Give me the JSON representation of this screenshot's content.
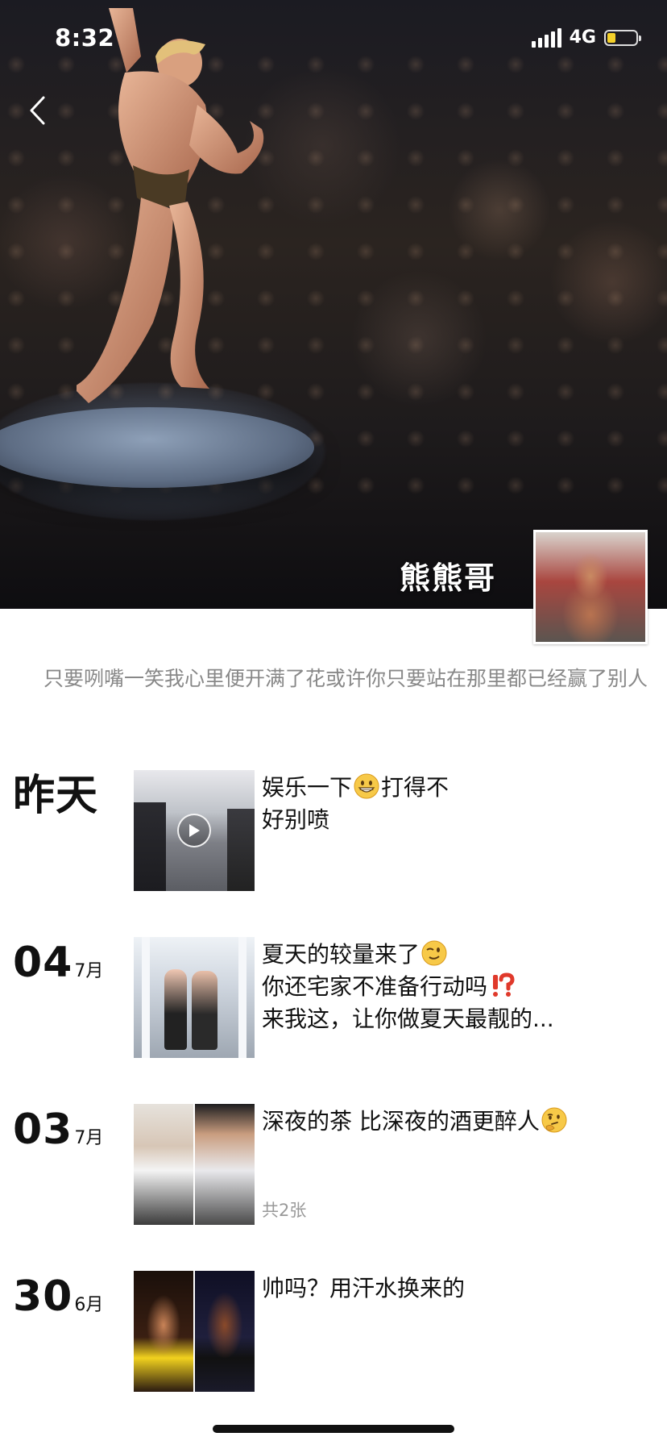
{
  "status_bar": {
    "time": "8:32",
    "network": "4G",
    "battery_percent": 30
  },
  "profile": {
    "name": "熊熊哥",
    "signature": "只要咧嘴一笑我心里便开满了花或许你只要站在那里都已经赢了别人"
  },
  "icons": {
    "back": "chevron-left-icon",
    "play": "play-icon",
    "signal": "signal-icon",
    "battery": "battery-icon"
  },
  "colors": {
    "battery_fill": "#f5d12a",
    "text_primary": "#111111",
    "text_secondary": "#888888"
  },
  "feed": [
    {
      "date_day": "昨天",
      "date_month": "",
      "lines": [
        "娱乐一下",
        "打得不",
        "好别喷"
      ],
      "type": "video"
    },
    {
      "date_day": "04",
      "date_month": "7月",
      "lines": [
        "夏天的较量来了",
        "你还宅家不准备行动吗",
        "来我这，让你做夏天最靓的..."
      ],
      "type": "image"
    },
    {
      "date_day": "03",
      "date_month": "7月",
      "lines": [
        "深夜的茶 比深夜的酒更醉人"
      ],
      "photo_count": "共2张",
      "type": "multi-image"
    },
    {
      "date_day": "30",
      "date_month": "6月",
      "lines": [
        "帅吗？用汗水换来的"
      ],
      "type": "multi-image"
    }
  ]
}
